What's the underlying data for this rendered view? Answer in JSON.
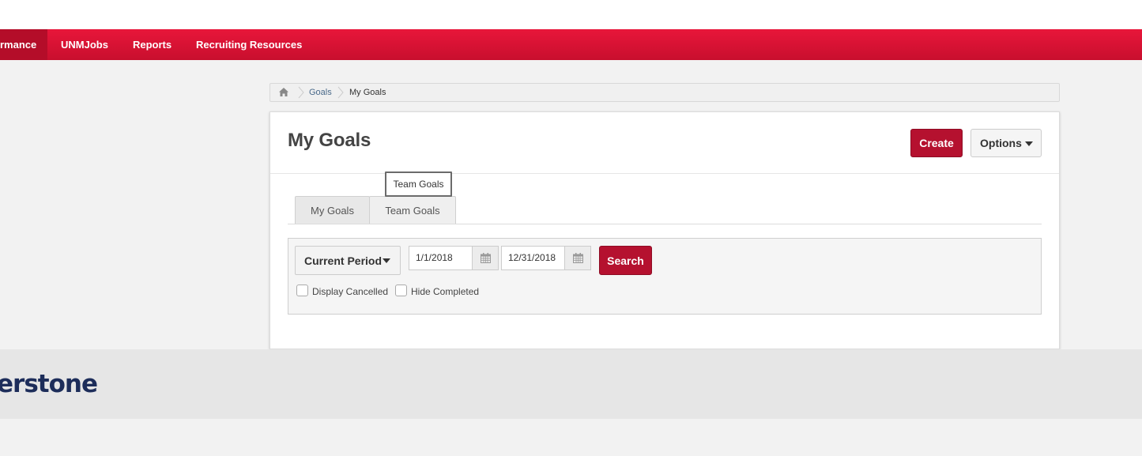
{
  "nav": {
    "items": [
      {
        "label": "rmance",
        "active": true
      },
      {
        "label": "UNMJobs",
        "active": false
      },
      {
        "label": "Reports",
        "active": false
      },
      {
        "label": "Recruiting Resources",
        "active": false
      }
    ],
    "accent_color": "#e8163a"
  },
  "breadcrumb": {
    "home_icon": "home-icon",
    "items": [
      "Goals",
      "My Goals"
    ]
  },
  "page": {
    "title": "My Goals",
    "create_label": "Create",
    "options_label": "Options"
  },
  "tooltip": "Team Goals",
  "tabs": [
    {
      "label": "My Goals",
      "active": true
    },
    {
      "label": "Team Goals",
      "active": false
    }
  ],
  "filters": {
    "period_label": "Current Period",
    "start_date": "1/1/2018",
    "end_date": "12/31/2018",
    "search_label": "Search",
    "display_cancelled_label": "Display Cancelled",
    "hide_completed_label": "Hide Completed",
    "display_cancelled_checked": false,
    "hide_completed_checked": false
  },
  "footer": {
    "logo_text": "erstone"
  }
}
